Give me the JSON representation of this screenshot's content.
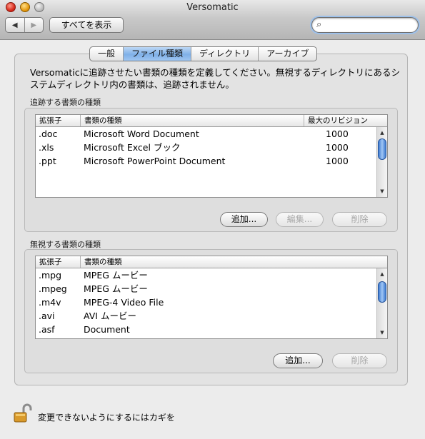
{
  "window": {
    "title": "Versomatic"
  },
  "toolbar": {
    "back_glyph": "◀",
    "forward_glyph": "▶",
    "show_all_label": "すべてを表示",
    "search_placeholder": "",
    "search_value": ""
  },
  "tabs": [
    {
      "label": "一般",
      "active": false
    },
    {
      "label": "ファイル種類",
      "active": true
    },
    {
      "label": "ディレクトリ",
      "active": false
    },
    {
      "label": "アーカイブ",
      "active": false
    }
  ],
  "description": "Versomaticに追跡させたい書類の種類を定義してください。無視するディレクトリにあるシステムディレクトリ内の書類は、追跡されません。",
  "tracked": {
    "group_label": "追跡する書類の種類",
    "columns": {
      "ext": "拡張子",
      "kind": "書類の種類",
      "max": "最大のリビジョン"
    },
    "rows": [
      {
        "ext": ".doc",
        "kind": "Microsoft Word Document",
        "max": "1000"
      },
      {
        "ext": ".xls",
        "kind": "Microsoft Excel ブック",
        "max": "1000"
      },
      {
        "ext": ".ppt",
        "kind": "Microsoft PowerPoint Document",
        "max": "1000"
      }
    ],
    "buttons": {
      "add": "追加...",
      "edit": "編集...",
      "delete": "削除"
    }
  },
  "ignored": {
    "group_label": "無視する書類の種類",
    "columns": {
      "ext": "拡張子",
      "kind": "書類の種類"
    },
    "rows": [
      {
        "ext": ".mpg",
        "kind": "MPEG ムービー"
      },
      {
        "ext": ".mpeg",
        "kind": "MPEG ムービー"
      },
      {
        "ext": ".m4v",
        "kind": "MPEG-4 Video File"
      },
      {
        "ext": ".avi",
        "kind": "AVI ムービー"
      },
      {
        "ext": ".asf",
        "kind": "Document"
      }
    ],
    "buttons": {
      "add": "追加...",
      "delete": "削除"
    }
  },
  "lock": {
    "text": "変更できないようにするにはカギを"
  },
  "colors": {
    "accent": "#7fb0e8",
    "scroll_thumb": "#3c7ad0"
  }
}
